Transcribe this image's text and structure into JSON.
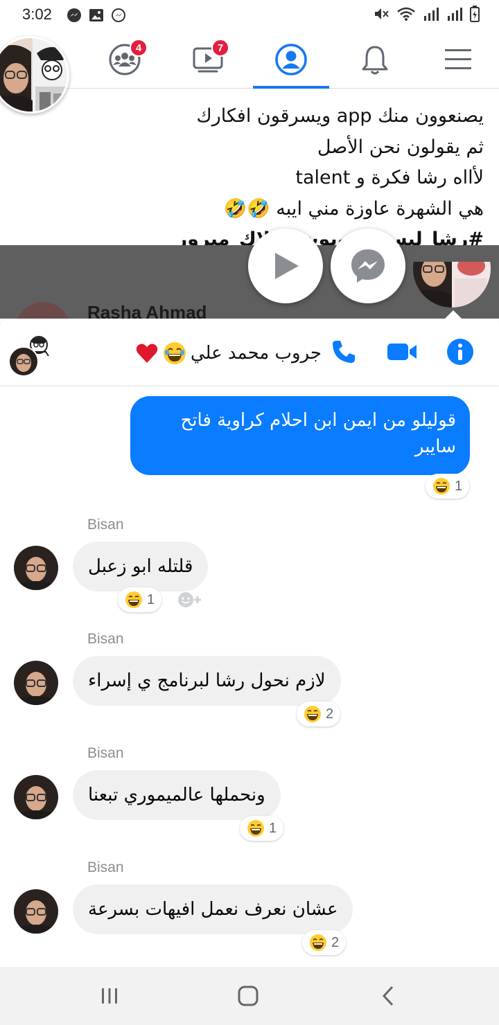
{
  "status_bar": {
    "time": "3:02"
  },
  "nav": {
    "groups_badge": "4",
    "watch_badge": "7",
    "active_color": "#1877f2",
    "badge_color": "#e41e3f"
  },
  "post": {
    "lines": [
      "يصنعوون منك app ويسرقون افكارك",
      "ثم يقولون نحن الأصل",
      "لأااه رشا فكرة و talent",
      "هي الشهرة عاوزة مني ايبه 🤣🤣",
      "#رشا_ليست_روبوت #بلاك_ميرور"
    ]
  },
  "underlay": {
    "name": "Rasha Ahmad"
  },
  "chat_header": {
    "title": "جروب محمد علي"
  },
  "messages": {
    "outgoing": {
      "text": "قوليلو من ايمن  ابن احلام كراوية فاتح سايبر",
      "reaction_count": "1",
      "color": "#0a7cff"
    },
    "incoming": [
      {
        "sender": "Bisan",
        "text": "قلتله ابو زعبل",
        "reaction_count": "1"
      },
      {
        "sender": "Bisan",
        "text": "لازم نحول رشا لبرنامج ي إسراء",
        "reaction_count": "2"
      },
      {
        "sender": "Bisan",
        "text": "ونحملها عالميموري تبعنا",
        "reaction_count": "1"
      },
      {
        "sender": "Bisan",
        "text": "عشان نعرف نعمل افيهات بسرعة",
        "reaction_count": "2"
      }
    ]
  },
  "icons": {
    "header_phone": "phone-icon",
    "header_video": "video-camera-icon",
    "header_info": "info-icon",
    "nav_groups": "groups-icon",
    "nav_watch": "watch-icon",
    "nav_profile": "profile-icon",
    "nav_notifications": "bell-icon",
    "nav_menu": "menu-icon",
    "android_recents": "recents-icon",
    "android_home": "home-icon",
    "android_back": "back-icon"
  }
}
